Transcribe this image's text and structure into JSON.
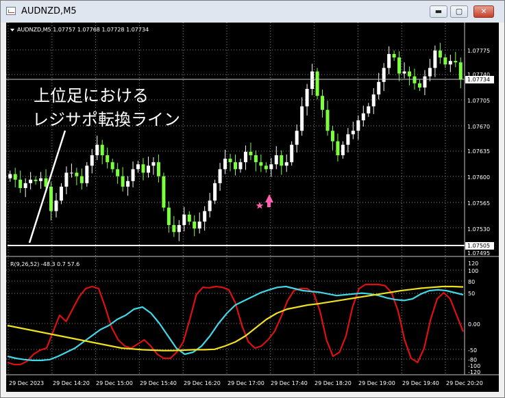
{
  "window": {
    "title": "AUDNZD,M5",
    "min_label": "▬",
    "max_label": "▢",
    "close_label": "✕"
  },
  "main_chart": {
    "header": "AUDNZD,M5  1.07757 1.07768 1.07728 1.07734",
    "price_ticks": [
      "1.07775",
      "1.07740",
      "1.07705",
      "1.07670",
      "1.07635",
      "1.07600",
      "1.07565",
      "1.07530",
      "1.07495"
    ],
    "current_price": "1.07734",
    "level_price": "1.07505",
    "annotation_line1": "上位足における",
    "annotation_line2": "レジサポ転換ライン"
  },
  "indicator": {
    "header": "R(9,26,52) -48.3 0.7 57.6",
    "ticks": [
      "120",
      "100",
      "80",
      "50",
      "0.00",
      "-50",
      "-80",
      "-100",
      "-120"
    ]
  },
  "time_axis": [
    "29 Dec 2023",
    "29 Dec 14:20",
    "29 Dec 15:00",
    "29 Dec 15:40",
    "29 Dec 16:20",
    "29 Dec 17:00",
    "29 Dec 17:40",
    "29 Dec 18:20",
    "29 Dec 19:00",
    "29 Dec 19:40",
    "29 Dec 20:20"
  ],
  "colors": {
    "bull": "#ffffff",
    "bear": "#7cff3c",
    "rsi_short": "#e01010",
    "rsi_mid": "#40d8e8",
    "rsi_long": "#f0e020",
    "arrow": "#ff60b0",
    "grid": "#8a8a8a"
  },
  "chart_data": [
    {
      "type": "candlestick",
      "symbol": "AUDNZD",
      "timeframe": "M5",
      "ylim": [
        1.07482,
        1.07815
      ],
      "grid": true,
      "closes": [
        1.07598,
        1.0759,
        1.07578,
        1.07585,
        1.0759,
        1.07588,
        1.07592,
        1.0758,
        1.07545,
        1.0756,
        1.0758,
        1.076,
        1.076,
        1.07595,
        1.07585,
        1.0761,
        1.07625,
        1.0764,
        1.07625,
        1.07615,
        1.07605,
        1.07595,
        1.0758,
        1.07588,
        1.07605,
        1.07612,
        1.076,
        1.0761,
        1.07615,
        1.07595,
        1.0755,
        1.07525,
        1.07515,
        1.07525,
        1.0754,
        1.0753,
        1.0752,
        1.0753,
        1.07545,
        1.0756,
        1.07585,
        1.07605,
        1.0762,
        1.07615,
        1.07605,
        1.07615,
        1.0763,
        1.07625,
        1.07615,
        1.0761,
        1.07605,
        1.07612,
        1.07625,
        1.0761,
        1.07615,
        1.0764,
        1.0766,
        1.07695,
        1.0772,
        1.07745,
        1.0771,
        1.0769,
        1.0766,
        1.07645,
        1.07625,
        1.0764,
        1.07655,
        1.0766,
        1.07675,
        1.07685,
        1.07695,
        1.07712,
        1.0773,
        1.0775,
        1.0777,
        1.07765,
        1.07742,
        1.07745,
        1.07738,
        1.07728,
        1.07722,
        1.07738,
        1.0775,
        1.07775,
        1.07765,
        1.07755,
        1.0776,
        1.07758,
        1.07734
      ]
    },
    {
      "type": "line",
      "title": "R(9,26,52)",
      "ylim": [
        -120,
        120
      ],
      "series": [
        {
          "values": [
            -95,
            -100,
            -100,
            -92,
            -75,
            -65,
            -60,
            -20,
            20,
            5,
            35,
            65,
            85,
            90,
            85,
            40,
            -10,
            -40,
            -55,
            -60,
            -50,
            -40,
            -55,
            -75,
            -85,
            -85,
            -70,
            -45,
            10,
            70,
            88,
            87,
            90,
            88,
            82,
            50,
            -5,
            -45,
            -60,
            -55,
            -40,
            -20,
            15,
            55,
            80,
            85,
            85,
            75,
            30,
            -40,
            -80,
            -70,
            -30,
            40,
            85,
            95,
            95,
            95,
            92,
            75,
            30,
            -40,
            -85,
            -95,
            -60,
            10,
            60,
            75,
            60,
            20,
            -20
          ]
        },
        {
          "values": [
            -80,
            -85,
            -88,
            -90,
            -90,
            -88,
            -80,
            -70,
            -60,
            -45,
            -30,
            -15,
            -5,
            10,
            20,
            35,
            40,
            25,
            0,
            -30,
            -60,
            -75,
            -70,
            -55,
            -30,
            0,
            25,
            45,
            55,
            65,
            75,
            82,
            88,
            90,
            85,
            80,
            78,
            76,
            72,
            68,
            70,
            72,
            74,
            72,
            68,
            62,
            58,
            56,
            60,
            72,
            80,
            82,
            80,
            75,
            70
          ]
        },
        {
          "values": [
            -5,
            -10,
            -15,
            -20,
            -25,
            -30,
            -35,
            -40,
            -45,
            -50,
            -55,
            -60,
            -62,
            -64,
            -65,
            -66,
            -66,
            -65,
            -64,
            -64,
            -63,
            -55,
            -45,
            -30,
            -10,
            10,
            25,
            35,
            40,
            45,
            48,
            52,
            56,
            60,
            64,
            68,
            72,
            76,
            80,
            83,
            86,
            88,
            90,
            90,
            89
          ]
        }
      ]
    }
  ]
}
